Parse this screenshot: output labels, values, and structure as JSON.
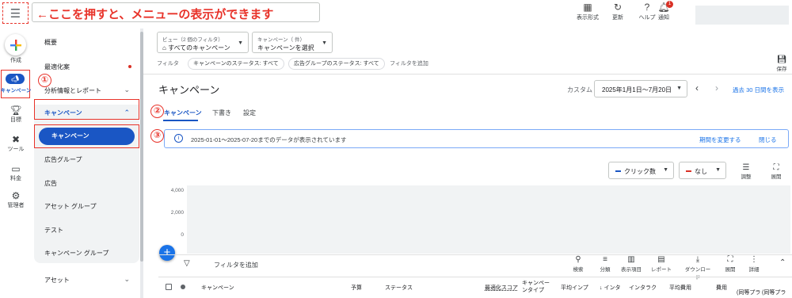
{
  "top": {
    "menu_icon": "hamburger-icon",
    "hint": "←ここを押すと、メニューの表示ができます",
    "items": [
      {
        "label": "表示形式",
        "icon": "view-icon"
      },
      {
        "label": "更新",
        "icon": "refresh-icon"
      },
      {
        "label": "ヘルプ",
        "icon": "help-icon"
      },
      {
        "label": "通知",
        "icon": "bell-icon"
      }
    ],
    "notification_count": "1"
  },
  "rail": {
    "create": "作成",
    "campaign": "キャンペーン",
    "goals": "目標",
    "tools": "ツール",
    "billing": "料金",
    "admin": "管理者"
  },
  "nav": {
    "overview": "概要",
    "recommendations": "最適化案",
    "insights": "分析情報とレポート",
    "campaigns_group": "キャンペーン",
    "campaigns": "キャンペーン",
    "ad_groups": "広告グループ",
    "ads": "広告",
    "asset_groups": "アセット グループ",
    "tests": "テスト",
    "campaign_groups": "キャンペーン グループ",
    "assets": "アセット"
  },
  "annotations": {
    "one": "①",
    "two": "②",
    "three": "③"
  },
  "filters": {
    "view_label": "ビュー（2 個のフィルタ）",
    "view_value": "すべてのキャンペーン",
    "campaign_label": "キャンペーン（ 件）",
    "campaign_value": "キャンペーンを選択",
    "filter_label": "フィルタ",
    "chips": [
      "キャンペーンのステータス: すべて",
      "広告グループのステータス: すべて"
    ],
    "add_filter": "フィルタを追加",
    "save": "保存"
  },
  "header": {
    "title": "キャンペーン",
    "custom": "カスタム",
    "date_range": "2025年1月1日～7月20日",
    "last30": "過去 30 日間を表示"
  },
  "tabs": [
    "キャンペーン",
    "下書き",
    "設定"
  ],
  "banner": {
    "text": "2025-01-01～2025-07-20までのデータが表示されています",
    "change_period": "期間を変更する",
    "close": "閉じる"
  },
  "chart": {
    "metric1": "クリック数",
    "metric2": "なし",
    "adjust": "調整",
    "expand": "展開"
  },
  "chart_data": {
    "type": "line",
    "yticks": [
      "4,000",
      "2,000",
      "0"
    ],
    "ylim": [
      0,
      4000
    ],
    "series": []
  },
  "toolbar": {
    "add_filter": "フィルタを追加",
    "tools": [
      "検索",
      "分類",
      "表示項目",
      "レポート",
      "ダウンロード",
      "展開",
      "詳細"
    ]
  },
  "table": {
    "headers": [
      "キャンペーン",
      "予算",
      "ステータス",
      "最適化スコア",
      "キャンペーンタイプ",
      "平均インプ",
      "↓ インタ",
      "インタラク",
      "平均費用",
      "費用",
      "(同等プラ",
      "(同等プラ"
    ]
  },
  "colors": {
    "accent": "#1a56c4",
    "annotation_red": "#e8332a",
    "link": "#1a73e8"
  }
}
